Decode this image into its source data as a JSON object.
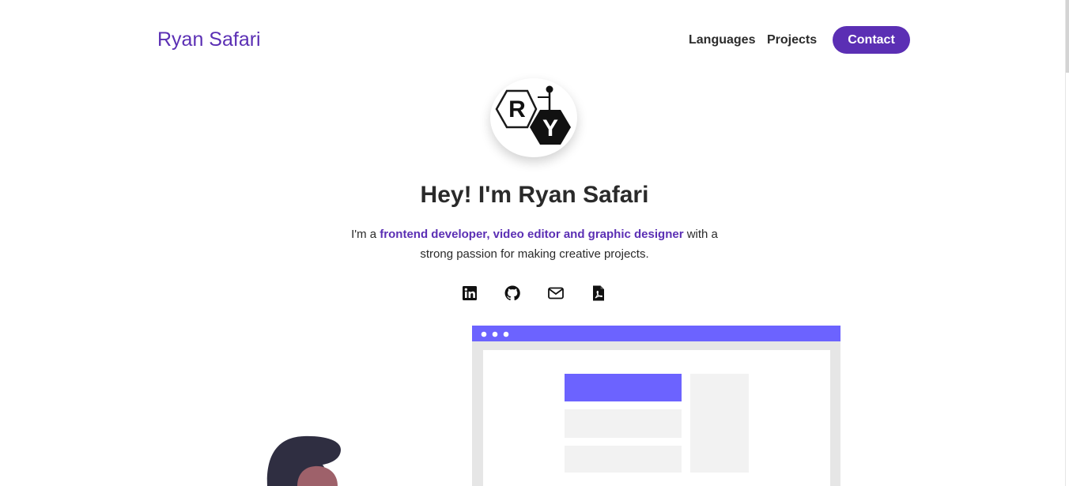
{
  "nav": {
    "brand": "Ryan Safari",
    "links": [
      "Languages",
      "Projects"
    ],
    "contact_label": "Contact"
  },
  "hero": {
    "avatar_letters": [
      "R",
      "Y"
    ],
    "headline": "Hey! I'm Ryan Safari",
    "intro_prefix": "I'm a ",
    "intro_highlight": "frontend developer, video editor and graphic designer",
    "intro_suffix_line1": " with a",
    "intro_line2": "strong passion for making creative projects."
  },
  "social": [
    {
      "icon": "linkedin-icon"
    },
    {
      "icon": "github-icon"
    },
    {
      "icon": "mail-icon"
    },
    {
      "icon": "pdf-resume-icon"
    }
  ],
  "colors": {
    "accent": "#5b2fb4",
    "illustration_accent": "#6c63ff",
    "text": "#2a2a2a"
  }
}
